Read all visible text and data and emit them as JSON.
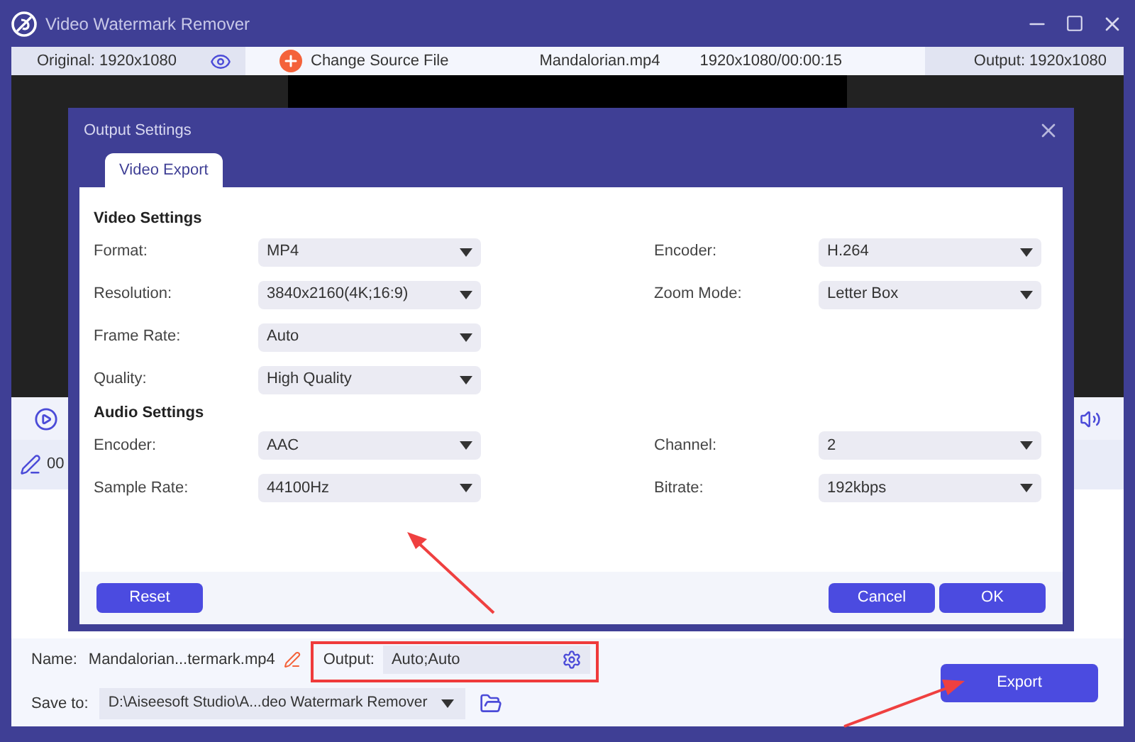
{
  "window": {
    "title": "Video Watermark Remover"
  },
  "info_bar": {
    "original": "Original: 1920x1080",
    "change_source": "Change Source File",
    "file_name": "Mandalorian.mp4",
    "file_info": "1920x1080/00:00:15",
    "output": "Output: 1920x1080"
  },
  "timeline": {
    "time": "00"
  },
  "dialog": {
    "title": "Output Settings",
    "tabs": [
      {
        "label": "Video Export",
        "selected": true
      }
    ],
    "sections": [
      {
        "title": "Video Settings",
        "left": [
          {
            "label": "Format:",
            "value": "MP4"
          },
          {
            "label": "Resolution:",
            "value": "3840x2160(4K;16:9)"
          },
          {
            "label": "Frame Rate:",
            "value": "Auto"
          },
          {
            "label": "Quality:",
            "value": "High Quality"
          }
        ],
        "right": [
          {
            "label": "Encoder:",
            "value": "H.264"
          },
          {
            "label": "Zoom Mode:",
            "value": "Letter Box"
          }
        ]
      },
      {
        "title": "Audio Settings",
        "left": [
          {
            "label": "Encoder:",
            "value": "AAC"
          },
          {
            "label": "Sample Rate:",
            "value": "44100Hz"
          }
        ],
        "right": [
          {
            "label": "Channel:",
            "value": "2"
          },
          {
            "label": "Bitrate:",
            "value": "192kbps"
          }
        ]
      }
    ],
    "buttons": {
      "reset": "Reset",
      "cancel": "Cancel",
      "ok": "OK"
    }
  },
  "bottom": {
    "name_label": "Name:",
    "name_value": "Mandalorian...termark.mp4",
    "output_label": "Output:",
    "output_value": "Auto;Auto",
    "save_label": "Save to:",
    "save_value": "D:\\Aiseesoft Studio\\A...deo Watermark Remover",
    "export": "Export"
  }
}
